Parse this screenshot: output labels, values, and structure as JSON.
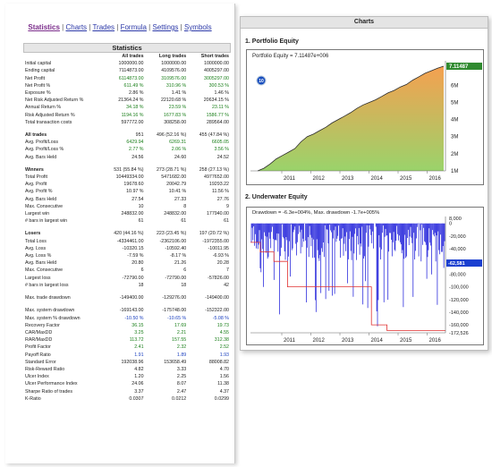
{
  "nav": {
    "items": [
      "Statistics",
      "Charts",
      "Trades",
      "Formula",
      "Settings",
      "Symbols"
    ],
    "active": "Statistics"
  },
  "statistics": {
    "title": "Statistics",
    "columns": [
      "",
      "All trades",
      "Long trades",
      "Short trades"
    ],
    "rows": [
      {
        "label": "Initial capital",
        "vals": [
          "1000000.00",
          "1000000.00",
          "1000000.00"
        ],
        "style": ""
      },
      {
        "label": "Ending capital",
        "vals": [
          "7114873.00",
          "4109576.00",
          "4005297.00"
        ],
        "style": ""
      },
      {
        "label": "Net Profit",
        "vals": [
          "6114873.00",
          "3109576.00",
          "3005297.00"
        ],
        "style": "g"
      },
      {
        "label": "Net Profit %",
        "vals": [
          "611.49 %",
          "310.96 %",
          "300.53 %"
        ],
        "style": "g"
      },
      {
        "label": "Exposure %",
        "vals": [
          "2.86 %",
          "1.41 %",
          "1.46 %"
        ],
        "style": ""
      },
      {
        "label": "Net Risk Adjusted Return %",
        "vals": [
          "21364.24 %",
          "22120.68 %",
          "20634.15 %"
        ],
        "style": ""
      },
      {
        "label": "Annual Return %",
        "vals": [
          "34.18 %",
          "23.59 %",
          "23.11 %"
        ],
        "style": "g"
      },
      {
        "label": "Risk Adjusted Return %",
        "vals": [
          "1194.16 %",
          "1677.83 %",
          "1586.77 %"
        ],
        "style": "g"
      },
      {
        "label": "Total transaction costs",
        "vals": [
          "597772.00",
          "308258.00",
          "289564.00"
        ],
        "style": ""
      },
      {
        "label": "",
        "vals": [
          "",
          "",
          ""
        ],
        "style": "spacer"
      },
      {
        "label": "All trades",
        "vals": [
          "951",
          "496 (52.16 %)",
          "455 (47.84 %)"
        ],
        "style": "sec"
      },
      {
        "label": "Avg. Profit/Loss",
        "vals": [
          "6429.94",
          "6269.31",
          "6605.05"
        ],
        "style": "g"
      },
      {
        "label": "Avg. Profit/Loss %",
        "vals": [
          "2.77 %",
          "2.06 %",
          "3.56 %"
        ],
        "style": "g"
      },
      {
        "label": "Avg. Bars Held",
        "vals": [
          "24.56",
          "24.60",
          "24.52"
        ],
        "style": ""
      },
      {
        "label": "",
        "vals": [
          "",
          "",
          ""
        ],
        "style": "spacer"
      },
      {
        "label": "Winners",
        "vals": [
          "531 (55.84 %)",
          "273 (28.71 %)",
          "258 (27.13 %)"
        ],
        "style": "sec"
      },
      {
        "label": "Total Profit",
        "vals": [
          "10449334.00",
          "5471682.00",
          "4977652.00"
        ],
        "style": ""
      },
      {
        "label": "Avg. Profit",
        "vals": [
          "19678.60",
          "20042.79",
          "19293.22"
        ],
        "style": ""
      },
      {
        "label": "Avg. Profit %",
        "vals": [
          "10.97 %",
          "10.41 %",
          "11.56 %"
        ],
        "style": ""
      },
      {
        "label": "Avg. Bars Held",
        "vals": [
          "27.54",
          "27.33",
          "27.76"
        ],
        "style": ""
      },
      {
        "label": "Max. Consecutive",
        "vals": [
          "10",
          "8",
          "9"
        ],
        "style": ""
      },
      {
        "label": "Largest win",
        "vals": [
          "248832.00",
          "248832.00",
          "177940.00"
        ],
        "style": ""
      },
      {
        "label": "# bars in largest win",
        "vals": [
          "61",
          "61",
          "61"
        ],
        "style": ""
      },
      {
        "label": "",
        "vals": [
          "",
          "",
          ""
        ],
        "style": "spacer"
      },
      {
        "label": "Losers",
        "vals": [
          "420 (44.16 %)",
          "223 (23.45 %)",
          "197 (20.72 %)"
        ],
        "style": "sec"
      },
      {
        "label": "Total Loss",
        "vals": [
          "-4334461.00",
          "-2362106.00",
          "-1972355.00"
        ],
        "style": ""
      },
      {
        "label": "Avg. Loss",
        "vals": [
          "-10320.15",
          "-10592.40",
          "-10011.95"
        ],
        "style": ""
      },
      {
        "label": "Avg. Loss %",
        "vals": [
          "-7.59 %",
          "-8.17 %",
          "-6.93 %"
        ],
        "style": ""
      },
      {
        "label": "Avg. Bars Held",
        "vals": [
          "20.80",
          "21.26",
          "20.28"
        ],
        "style": ""
      },
      {
        "label": "Max. Consecutive",
        "vals": [
          "6",
          "6",
          "7"
        ],
        "style": ""
      },
      {
        "label": "Largest loss",
        "vals": [
          "-72790.00",
          "-72790.00",
          "-57826.00"
        ],
        "style": ""
      },
      {
        "label": "# bars in largest loss",
        "vals": [
          "18",
          "18",
          "42"
        ],
        "style": ""
      },
      {
        "label": "",
        "vals": [
          "",
          "",
          ""
        ],
        "style": "spacer"
      },
      {
        "label": "Max. trade drawdown",
        "vals": [
          "-149400.00",
          "-129276.00",
          "-149400.00"
        ],
        "style": ""
      },
      {
        "label": "",
        "vals": [
          "",
          "",
          ""
        ],
        "style": "spacer"
      },
      {
        "label": "Max. system drawdown",
        "vals": [
          "-169143.00",
          "-175748.00",
          "-152322.00"
        ],
        "style": ""
      },
      {
        "label": "Max. system % drawdown",
        "vals": [
          "-10.50 %",
          "-10.65 %",
          "-5.08 %"
        ],
        "style": "b"
      },
      {
        "label": "Recovery Factor",
        "vals": [
          "36.15",
          "17.69",
          "19.73"
        ],
        "style": "g"
      },
      {
        "label": "CAR/MaxDD",
        "vals": [
          "3.25",
          "2.21",
          "4.55"
        ],
        "style": "g"
      },
      {
        "label": "RAR/MaxDD",
        "vals": [
          "113.72",
          "157.55",
          "312.38"
        ],
        "style": "g"
      },
      {
        "label": "Profit Factor",
        "vals": [
          "2.41",
          "2.32",
          "2.52"
        ],
        "style": "g"
      },
      {
        "label": "Payoff Ratio",
        "vals": [
          "1.91",
          "1.89",
          "1.93"
        ],
        "style": "b"
      },
      {
        "label": "Standard Error",
        "vals": [
          "192038.96",
          "153658.49",
          "88008.82"
        ],
        "style": ""
      },
      {
        "label": "Risk-Reward Ratio",
        "vals": [
          "4.82",
          "3.33",
          "4.70"
        ],
        "style": ""
      },
      {
        "label": "Ulcer Index",
        "vals": [
          "1.20",
          "2.25",
          "1.56"
        ],
        "style": ""
      },
      {
        "label": "Ulcer Performance Index",
        "vals": [
          "24.06",
          "8.07",
          "11.38"
        ],
        "style": ""
      },
      {
        "label": "Sharpe Ratio of trades",
        "vals": [
          "3.37",
          "2.47",
          "4.37"
        ],
        "style": ""
      },
      {
        "label": "K-Ratio",
        "vals": [
          "0.0307",
          "0.0212",
          "0.0299"
        ],
        "style": ""
      }
    ]
  },
  "charts_panel": {
    "header": "Charts"
  },
  "chart_data": [
    {
      "type": "area",
      "title": "1. Portfolio Equity",
      "legend": "Portfolio Equity = 7.11487e+006",
      "badge": "10",
      "last_value_label": "7.11487",
      "x": [
        "2011",
        "2012",
        "2013",
        "2014",
        "2015",
        "2016"
      ],
      "y_ticks": [
        "7M",
        "6M",
        "5M",
        "4M",
        "3M",
        "2M",
        "1M"
      ],
      "ylim": [
        1000000,
        7114873
      ],
      "series": [
        {
          "values": [
            1000000,
            1150000,
            1400000,
            1700000,
            1900000,
            2100000,
            2300000,
            2700000,
            3000000,
            3150000,
            3350000,
            3550000,
            3800000,
            4000000,
            4200000,
            4400000,
            4650000,
            4850000,
            5000000,
            5150000,
            5350000,
            5550000,
            5700000,
            5900000,
            6050000,
            6300000,
            6500000,
            6700000,
            6850000,
            7000000,
            7114873
          ]
        }
      ],
      "colors": {
        "fill_top": "#f5a050",
        "fill_bottom": "#9ad36b",
        "line": "#2b2b2b"
      }
    },
    {
      "type": "line",
      "title": "2. Underwater Equity",
      "legend": "Drawdown = -6.3e+004%, Max. drawdown -1.7e+005%",
      "last_value_label": "-62,581",
      "x": [
        "2011",
        "2012",
        "2013",
        "2014",
        "2015",
        "2016"
      ],
      "y_ticks": [
        "8,000",
        "0",
        "-20,000",
        "-40,000",
        "-60,000",
        "-80,000",
        "-100,000",
        "-120,000",
        "-140,000",
        "-160,000",
        "-172,526"
      ],
      "ylim": [
        -172526,
        8000
      ],
      "colors": {
        "drawdown": "#1212d8",
        "max_drawdown": "#e03030"
      }
    }
  ]
}
